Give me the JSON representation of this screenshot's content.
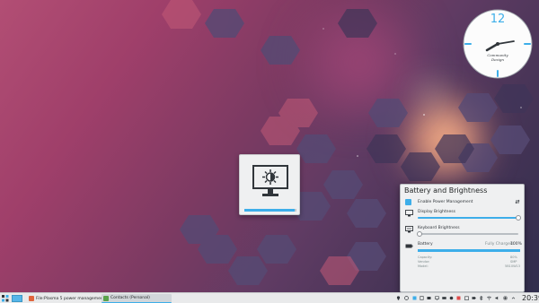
{
  "popup": {
    "title": "Battery and Brightness",
    "power_management_label": "Enable Power Management",
    "power_management_checked": true,
    "display_brightness_label": "Display Brightness",
    "display_brightness_level": 1.0,
    "keyboard_brightness_label": "Keyboard Brightness",
    "keyboard_brightness_level": 0.0,
    "battery_label": "Battery",
    "battery_status": "Fully Charged:",
    "battery_percent": "100%",
    "battery_level": 1.0,
    "details": [
      {
        "label": "Capacity:",
        "value": "80%"
      },
      {
        "label": "Vendor:",
        "value": "SMP"
      },
      {
        "label": "Model:",
        "value": "5B10W13"
      }
    ]
  },
  "osd": {
    "icon": "monitor-brightness-icon",
    "level": 0.97
  },
  "clock_widget": {
    "numeral": "12",
    "brand_line1": "Community",
    "brand_line2": "Design"
  },
  "taskbar": {
    "tasks": [
      {
        "label": "File:Plasma 5 power management...",
        "icon": "browser-icon",
        "active": false
      },
      {
        "label": "Contacts (Personal)",
        "icon": "contacts-icon",
        "active": true
      }
    ],
    "time": "20:39"
  },
  "colors": {
    "accent": "#3daee9",
    "panel": "#eff0f1"
  }
}
